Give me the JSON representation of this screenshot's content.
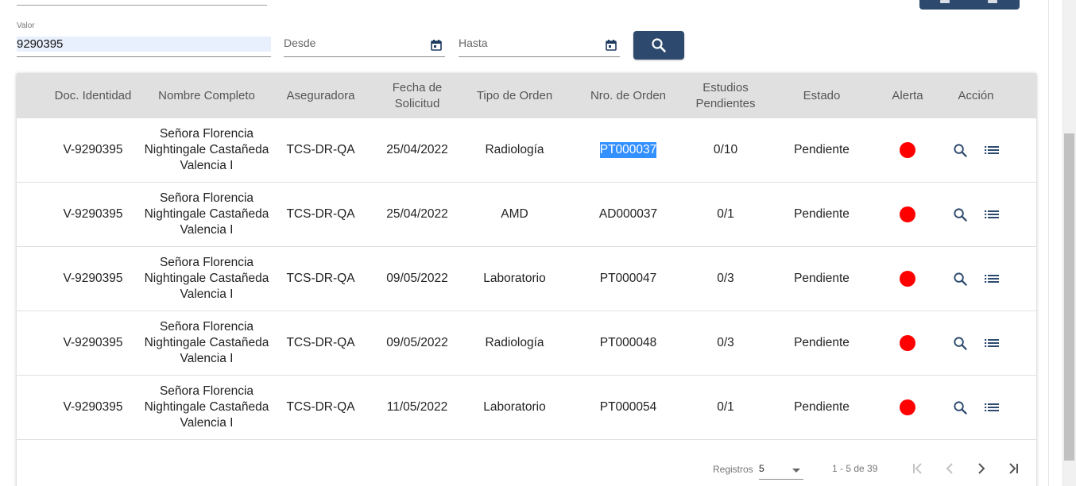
{
  "filters": {
    "valor_label": "Valor",
    "valor_value": "9290395",
    "desde_label": "Desde",
    "hasta_label": "Hasta",
    "search_icon": "search-icon",
    "calendar_icon": "calendar-icon"
  },
  "table": {
    "headers": {
      "doc": "Doc. Identidad",
      "nombre": "Nombre Completo",
      "aseguradora": "Aseguradora",
      "fecha_1": "Fecha de",
      "fecha_2": "Solicitud",
      "tipo": "Tipo de Orden",
      "nro": "Nro. de Orden",
      "estudios_1": "Estudios",
      "estudios_2": "Pendientes",
      "estado": "Estado",
      "alerta": "Alerta",
      "accion": "Acción"
    },
    "rows": [
      {
        "doc": "V-9290395",
        "nombre": "Señora Florencia Nightingale Castañeda Valencia I",
        "aseguradora": "TCS-DR-QA",
        "fecha": "25/04/2022",
        "tipo": "Radiología",
        "nro": "PT000037",
        "estudios": "0/10",
        "estado": "Pendiente",
        "alerta_color": "#ff0000"
      },
      {
        "doc": "V-9290395",
        "nombre": "Señora Florencia Nightingale Castañeda Valencia I",
        "aseguradora": "TCS-DR-QA",
        "fecha": "25/04/2022",
        "tipo": "AMD",
        "nro": "AD000037",
        "estudios": "0/1",
        "estado": "Pendiente",
        "alerta_color": "#ff0000"
      },
      {
        "doc": "V-9290395",
        "nombre": "Señora Florencia Nightingale Castañeda Valencia I",
        "aseguradora": "TCS-DR-QA",
        "fecha": "09/05/2022",
        "tipo": "Laboratorio",
        "nro": "PT000047",
        "estudios": "0/3",
        "estado": "Pendiente",
        "alerta_color": "#ff0000"
      },
      {
        "doc": "V-9290395",
        "nombre": "Señora Florencia Nightingale Castañeda Valencia I",
        "aseguradora": "TCS-DR-QA",
        "fecha": "09/05/2022",
        "tipo": "Radiología",
        "nro": "PT000048",
        "estudios": "0/3",
        "estado": "Pendiente",
        "alerta_color": "#ff0000"
      },
      {
        "doc": "V-9290395",
        "nombre": "Señora Florencia Nightingale Castañeda Valencia I",
        "aseguradora": "TCS-DR-QA",
        "fecha": "11/05/2022",
        "tipo": "Laboratorio",
        "nro": "PT000054",
        "estudios": "0/1",
        "estado": "Pendiente",
        "alerta_color": "#ff0000"
      }
    ],
    "selected_text_row": 0,
    "action_icons": [
      "search-icon",
      "list-icon"
    ]
  },
  "pagination": {
    "registros_label": "Registros",
    "page_size": "5",
    "range_text": "1 - 5 de 39",
    "icons": [
      "first-page-icon",
      "prev-page-icon",
      "next-page-icon",
      "last-page-icon"
    ]
  },
  "colors": {
    "primary": "#2d4a6e",
    "header_bg": "#e0e0e0",
    "alert": "#ff0000",
    "selection": "#3390ff",
    "input_autofill": "#e8f0fe"
  }
}
